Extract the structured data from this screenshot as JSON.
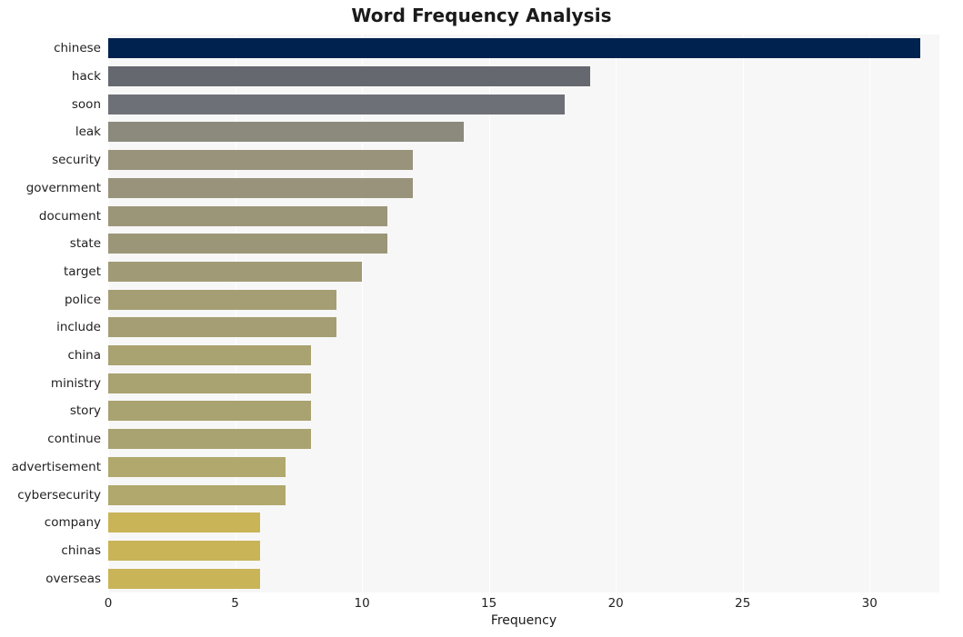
{
  "chart_data": {
    "type": "bar",
    "orientation": "horizontal",
    "title": "Word Frequency Analysis",
    "xlabel": "Frequency",
    "ylabel": "",
    "categories": [
      "chinese",
      "hack",
      "soon",
      "leak",
      "security",
      "government",
      "document",
      "state",
      "target",
      "police",
      "include",
      "china",
      "ministry",
      "story",
      "continue",
      "advertisement",
      "cybersecurity",
      "company",
      "chinas",
      "overseas"
    ],
    "values": [
      32,
      19,
      18,
      14,
      12,
      12,
      11,
      11,
      10,
      9,
      9,
      8,
      8,
      8,
      8,
      7,
      7,
      6,
      6,
      6
    ],
    "bar_colors": [
      "#00224e",
      "#65686f",
      "#6e7077",
      "#8b8a7d",
      "#98937a",
      "#98937a",
      "#9c9678",
      "#9c9678",
      "#a19a76",
      "#a59e74",
      "#a59e74",
      "#a9a271",
      "#a9a271",
      "#a9a271",
      "#a9a271",
      "#b0a86d",
      "#b0a86d",
      "#c9b458",
      "#c9b458",
      "#c9b458"
    ],
    "xticks": [
      0,
      5,
      10,
      15,
      20,
      25,
      30
    ],
    "xlim": [
      0,
      32.75
    ],
    "grid": true,
    "grid_axis": "x",
    "grid_color": "#ffffff",
    "plot_background": "#f7f7f7",
    "figure_background": "#ffffff",
    "legend": null,
    "colormap": "cividis"
  }
}
